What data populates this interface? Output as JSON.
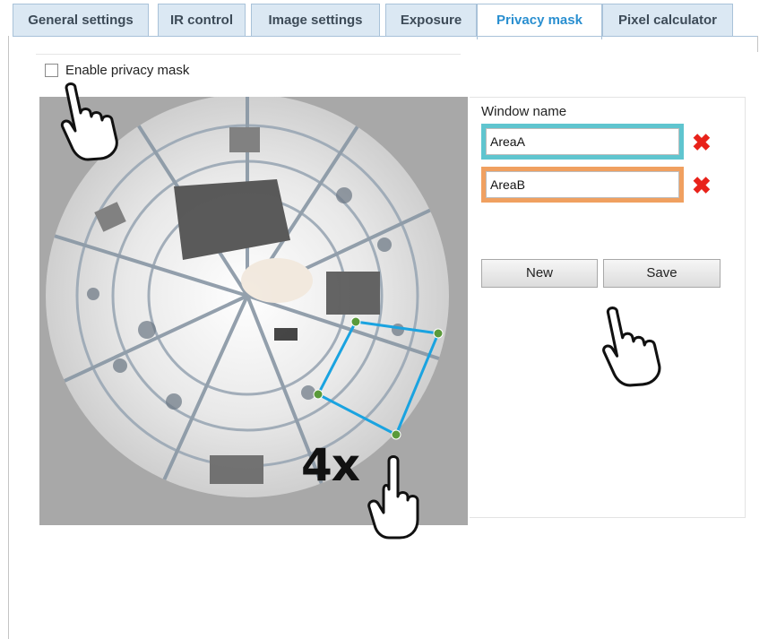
{
  "tabs": [
    {
      "label": "General settings",
      "active": false
    },
    {
      "label": "IR control",
      "active": false
    },
    {
      "label": "Image settings",
      "active": false
    },
    {
      "label": "Exposure",
      "active": false
    },
    {
      "label": "Privacy mask",
      "active": true
    },
    {
      "label": "Pixel calculator",
      "active": false
    }
  ],
  "privacy": {
    "enable_label": "Enable privacy mask",
    "enabled": false
  },
  "windows": {
    "header": "Window name",
    "items": [
      {
        "name": "AreaA",
        "color": "#5fc5cf"
      },
      {
        "name": "AreaB",
        "color": "#f0a060"
      }
    ],
    "delete_icon": "delete-x-icon"
  },
  "buttons": {
    "new_label": "New",
    "save_label": "Save"
  },
  "annotation": {
    "count_text": "4x"
  },
  "colors": {
    "active_tab": "#2a8fd0",
    "mask_outline": "#1aa3e0",
    "mask_points": "#5a9a3a",
    "delete": "#e8221a"
  },
  "icons": [
    "hand-pointer-icon",
    "delete-x-icon",
    "checkbox-icon"
  ]
}
